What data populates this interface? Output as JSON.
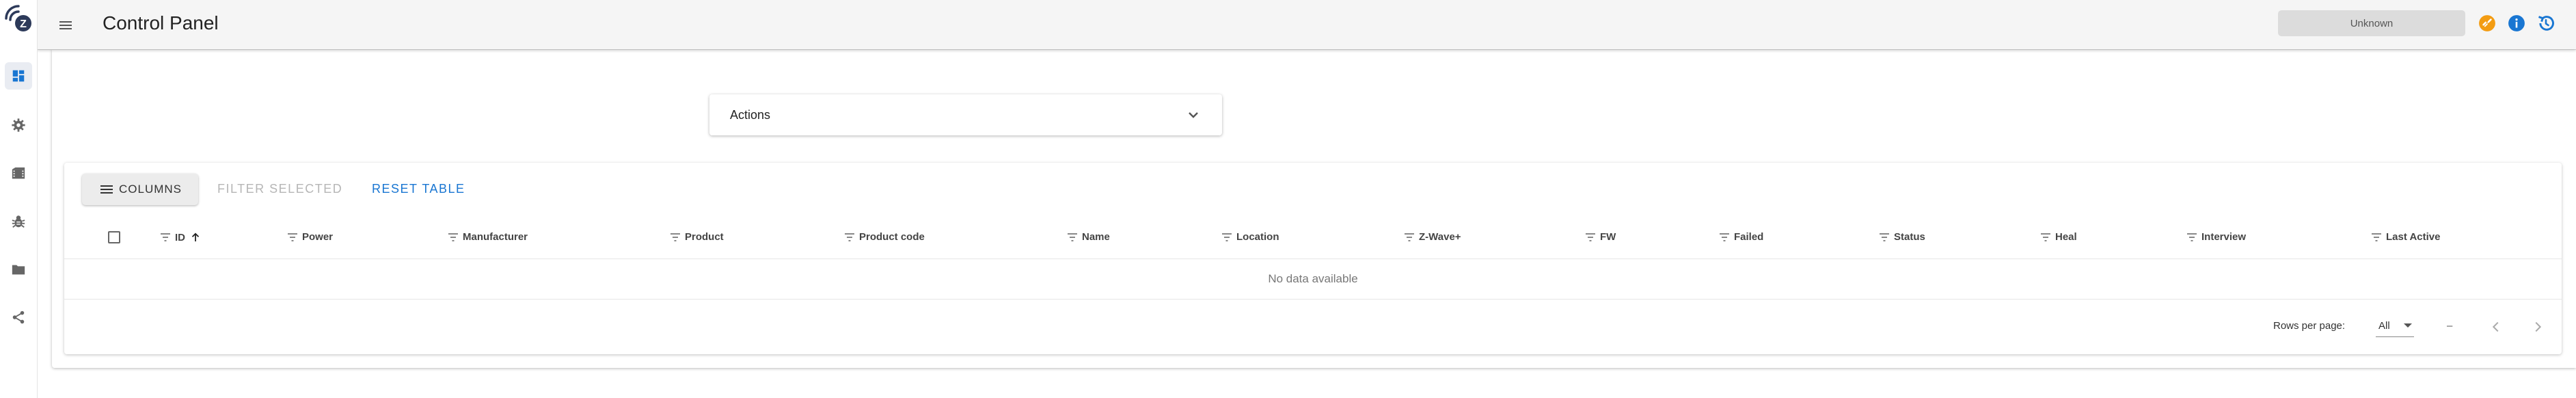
{
  "app": {
    "title": "Control Panel",
    "logo_letter": "Z"
  },
  "rail": {
    "items": [
      {
        "name": "control-panel",
        "icon": "dashboard-icon",
        "active": true
      },
      {
        "name": "settings",
        "icon": "gear-icon",
        "active": false
      },
      {
        "name": "scenes",
        "icon": "movie-icon",
        "active": false
      },
      {
        "name": "debug",
        "icon": "bug-icon",
        "active": false
      },
      {
        "name": "store",
        "icon": "folder-icon",
        "active": false
      },
      {
        "name": "mesh",
        "icon": "share-icon",
        "active": false
      }
    ]
  },
  "topbar": {
    "status": "Unknown",
    "icons": [
      "link-off-icon",
      "info-icon",
      "history-icon"
    ],
    "colors": {
      "warning": "#f39c12",
      "primary": "#1976d2"
    }
  },
  "actions": {
    "label": "Actions"
  },
  "table": {
    "toolbar": {
      "columns_label": "COLUMNS",
      "filter_label": "FILTER SELECTED",
      "reset_label": "RESET TABLE"
    },
    "columns": [
      "ID",
      "Power",
      "Manufacturer",
      "Product",
      "Product code",
      "Name",
      "Location",
      "Z-Wave+",
      "FW",
      "Failed",
      "Status",
      "Heal",
      "Interview",
      "Last Active"
    ],
    "sorted_column": "ID",
    "sort_direction": "asc",
    "empty_text": "No data available",
    "footer": {
      "rows_per_page_label": "Rows per page:",
      "rows_per_page_value": "All",
      "range_text": "–"
    }
  }
}
